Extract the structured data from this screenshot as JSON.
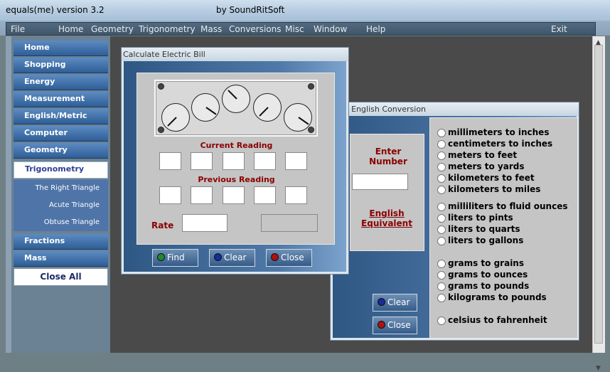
{
  "window": {
    "title": "equals(me)   version 3.2",
    "publisher": "by SoundRitSoft"
  },
  "menu": {
    "file": "File",
    "home": "Home",
    "geometry": "Geometry",
    "trigonometry": "Trigonometry",
    "mass": "Mass",
    "conversions": "Conversions",
    "misc": "Misc",
    "window": "Window",
    "help": "Help",
    "exit": "Exit"
  },
  "sidebar": {
    "items": [
      "Home",
      "Shopping",
      "Energy",
      "Measurement",
      "English/Metric",
      "Computer",
      "Geometry",
      "Trigonometry"
    ],
    "subitems": [
      "The Right Triangle",
      "Acute Triangle",
      "Obtuse Triangle"
    ],
    "after": [
      "Fractions",
      "Mass"
    ],
    "close_all": "Close All"
  },
  "bill": {
    "title": "Calculate Electric Bill",
    "current_label": "Current Reading",
    "previous_label": "Previous Reading",
    "rate_label": "Rate",
    "find": "Find",
    "clear": "Clear",
    "close": "Close"
  },
  "conversion": {
    "title": "ic to English Conversion",
    "enter_number": "Enter Number",
    "english_equivalent": "English Equivalent",
    "clear": "Clear",
    "close": "Close",
    "options": [
      "millimeters to inches",
      "centimeters to inches",
      "meters to feet",
      "meters to yards",
      "kilometers to feet",
      "kilometers to miles",
      "milliliters to fluid ounces",
      "liters to pints",
      "liters to quarts",
      "liters to gallons",
      "grams to grains",
      "grams to ounces",
      "grams to pounds",
      "kilograms to pounds",
      "celsius to fahrenheit"
    ]
  },
  "colors": {
    "find_dot": "#1e8a2e",
    "clear_dot": "#1a2a9a",
    "close_dot": "#b01010"
  }
}
